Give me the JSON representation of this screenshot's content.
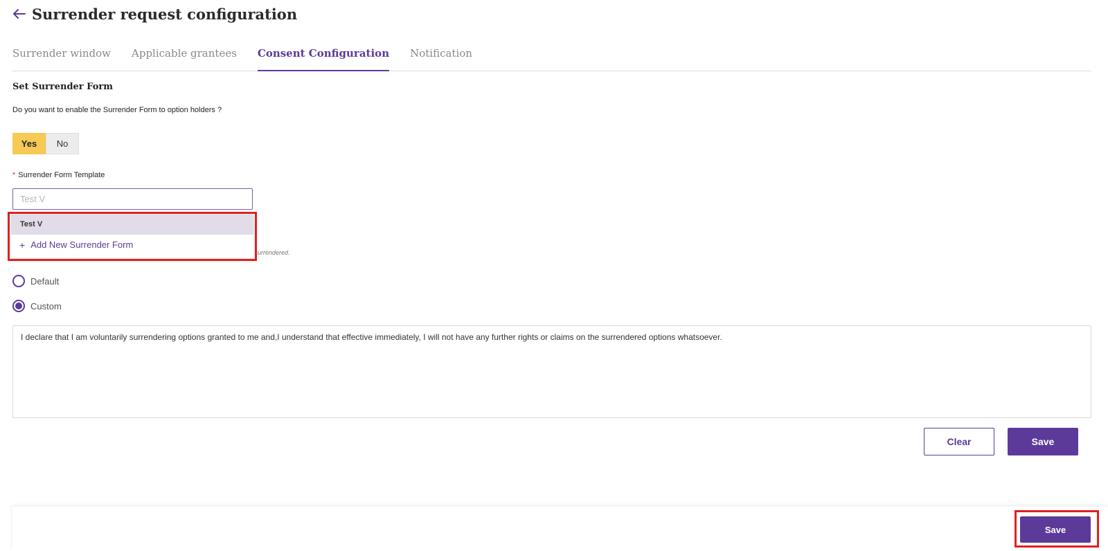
{
  "header": {
    "title": "Surrender request configuration",
    "back_icon": "arrow-left-icon"
  },
  "tabs": [
    {
      "label": "Surrender window",
      "active": false
    },
    {
      "label": "Applicable grantees",
      "active": false
    },
    {
      "label": "Consent Configuration",
      "active": true
    },
    {
      "label": "Notification",
      "active": false
    }
  ],
  "form": {
    "section_title": "Set Surrender Form",
    "question": "Do you want to enable the Surrender Form to option holders ?",
    "toggle": {
      "yes": "Yes",
      "no": "No",
      "selected": "Yes"
    },
    "template_label": "Surrender Form Template",
    "template_required": "*",
    "template_placeholder": "Test V",
    "dropdown": {
      "option": "Test V",
      "add_icon": "+",
      "add_label": "Add New Surrender Form"
    },
    "hidden_hint": "are surrendered."
  },
  "consent": {
    "options": [
      {
        "label": "Default",
        "selected": false
      },
      {
        "label": "Custom",
        "selected": true
      }
    ],
    "text": "I declare that I am voluntarily surrendering options granted to me and,I understand that effective immediately, I will not have any further rights or claims on the surrendered options whatsoever."
  },
  "actions": {
    "clear": "Clear",
    "save": "Save"
  },
  "footer": {
    "save": "Save"
  },
  "colors": {
    "accent": "#5b3a9a",
    "yes_bg": "#f7c955",
    "highlight": "#e02020"
  }
}
